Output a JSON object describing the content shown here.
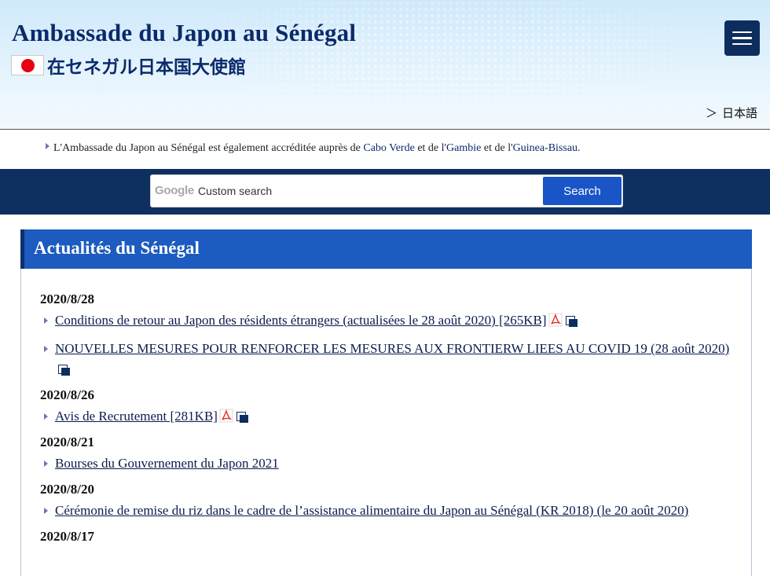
{
  "header": {
    "site_title": "Ambassade du Japon au Sénégal",
    "site_title_ja": "在セネガル日本国大使館",
    "language_link": "日本語",
    "language_arrow": "＞",
    "flag_icon": "japan-flag-icon",
    "menu_icon": "hamburger-menu-icon"
  },
  "accreditation": {
    "prefix": "L'Ambassade du Japon au Sénégal est également accréditée auprès de ",
    "country_1": "Cabo Verde",
    "mid_1": " et de l'",
    "country_2": "Gambie",
    "mid_2": " et de l'",
    "country_3": "Guinea-Bissau",
    "suffix": "."
  },
  "search": {
    "brand": "Google",
    "placeholder": "Custom search",
    "button_label": "Search"
  },
  "news": {
    "title": "Actualités du Sénégal",
    "groups": [
      {
        "date": "2020/8/28",
        "items": [
          {
            "text": "Conditions de retour au Japon des résidents étrangers (actualisées le 28 août 2020) [265KB]",
            "pdf": true,
            "external": true
          },
          {
            "text": "NOUVELLES MESURES POUR RENFORCER LES MESURES AUX FRONTIERW LIEES AU COVID 19 (28 août 2020)",
            "pdf": false,
            "external": true
          }
        ]
      },
      {
        "date": "2020/8/26",
        "items": [
          {
            "text": "Avis de Recrutement [281KB]",
            "pdf": true,
            "external": true
          }
        ]
      },
      {
        "date": "2020/8/21",
        "items": [
          {
            "text": "Bourses du Gouvernement du Japon 2021",
            "pdf": false,
            "external": false
          }
        ]
      },
      {
        "date": "2020/8/20",
        "items": [
          {
            "text": "Cérémonie de remise du riz dans le cadre de l’assistance alimentaire du Japon au Sénégal (KR 2018) (le 20 août 2020)",
            "pdf": false,
            "external": false
          }
        ]
      },
      {
        "date": "2020/8/17",
        "items": []
      }
    ]
  },
  "colors": {
    "navy": "#0f2f60",
    "accent_blue": "#1c5bbf",
    "search_button": "#1a55c8",
    "flag_red": "#e60012"
  }
}
